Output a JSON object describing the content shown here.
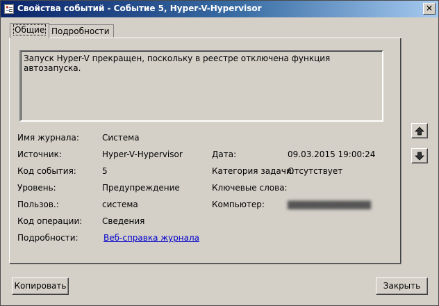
{
  "window": {
    "title": "Свойства событий - Событие 5, Hyper-V-Hypervisor",
    "close_glyph": "✕"
  },
  "tabs": [
    {
      "label": "Общие"
    },
    {
      "label": "Подробности"
    }
  ],
  "description": "Запуск Hyper-V прекращен, поскольку в реестре отключена функция автозапуска.",
  "fields": {
    "log_name": {
      "label": "Имя журнала:",
      "value": "Система"
    },
    "source": {
      "label": "Источник:",
      "value": "Hyper-V-Hypervisor"
    },
    "event_id": {
      "label": "Код события:",
      "value": "5"
    },
    "level": {
      "label": "Уровень:",
      "value": "Предупреждение"
    },
    "user": {
      "label": "Пользов.:",
      "value": "система"
    },
    "opcode": {
      "label": "Код операции:",
      "value": "Сведения"
    },
    "details": {
      "label": "Подробности:",
      "link": "Веб-справка журнала"
    },
    "date": {
      "label": "Дата:",
      "value": "09.03.2015 19:00:24"
    },
    "task_category": {
      "label": "Категория задачи:",
      "value": "Отсутствует"
    },
    "keywords": {
      "label": "Ключевые слова:",
      "value": ""
    },
    "computer": {
      "label": "Компьютер:",
      "value": ""
    }
  },
  "nav": {
    "up_icon": "arrow-up-icon",
    "down_icon": "arrow-down-icon"
  },
  "buttons": {
    "copy": "Копировать",
    "close": "Закрыть"
  }
}
